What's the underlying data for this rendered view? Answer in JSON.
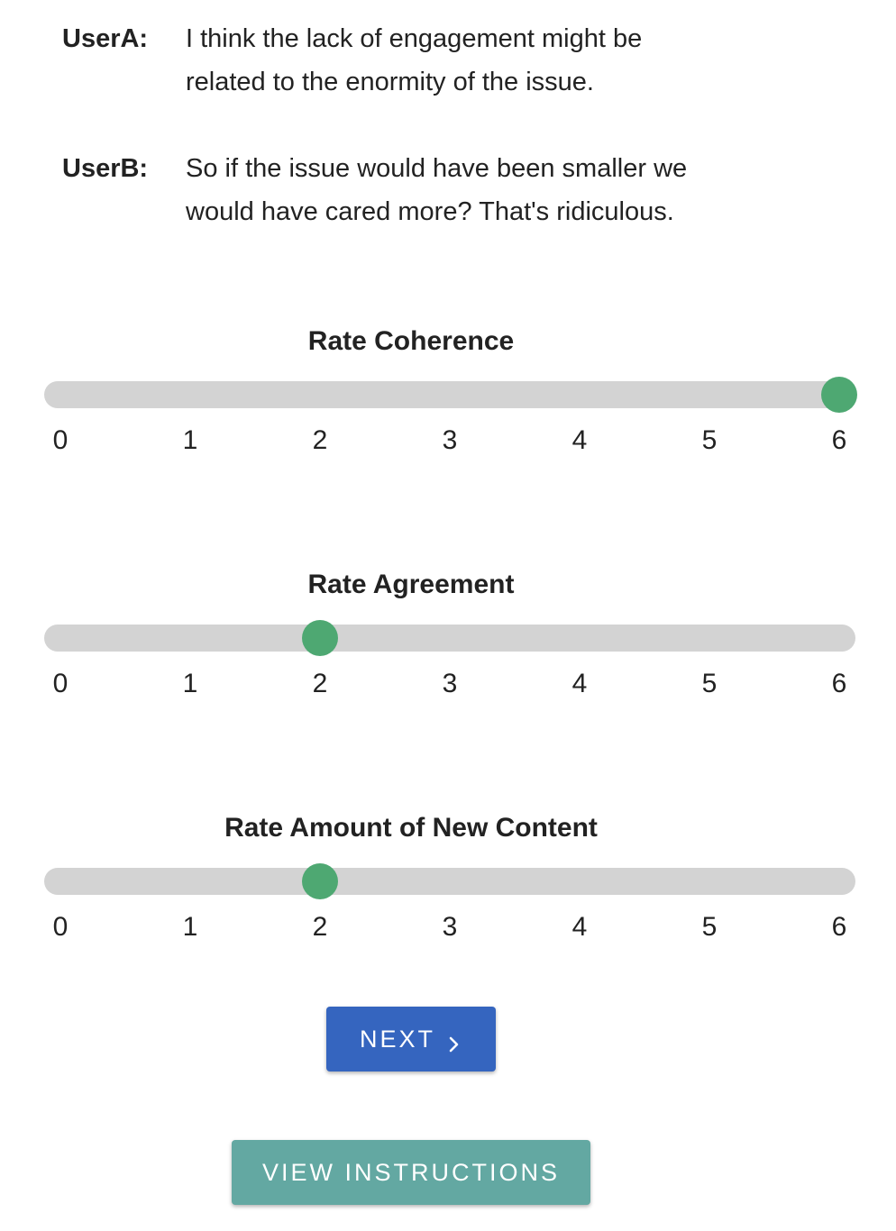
{
  "dialogue": [
    {
      "speaker": "UserA:",
      "lines": [
        "I think the lack of engagement might be",
        "related to the enormity of the issue."
      ]
    },
    {
      "speaker": "UserB:",
      "lines": [
        "So if the issue would have been smaller we",
        "would have cared more? That's ridiculous."
      ]
    }
  ],
  "scale": {
    "min": 0,
    "max": 6,
    "ticks": [
      "0",
      "1",
      "2",
      "3",
      "4",
      "5",
      "6"
    ]
  },
  "ratings": [
    {
      "title": "Rate Coherence",
      "value": 6
    },
    {
      "title": "Rate Agreement",
      "value": 2
    },
    {
      "title": "Rate Amount of New Content",
      "value": 2
    }
  ],
  "buttons": {
    "next_label": "NEXT",
    "instructions_label": "VIEW INSTRUCTIONS"
  },
  "colors": {
    "thumb": "#4ea872",
    "track": "#d3d3d3",
    "next_button": "#3565bf",
    "instructions_button": "#63a8a2"
  },
  "icons": {
    "next": "chevron-right-icon"
  }
}
